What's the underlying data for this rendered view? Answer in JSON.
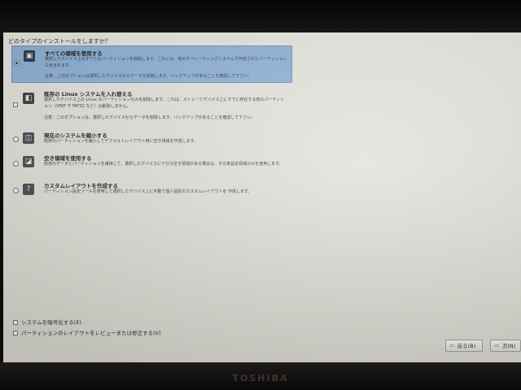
{
  "installer": {
    "question": "どのタイプのインストールをしますか？",
    "options": [
      {
        "title": "すべての領域を使用する",
        "description": "選択したデバイス上のすべてのパーティションを削除します。これには、他のオペレーティングシステムで作成されたパーティションも含まれます。",
        "warning": "注意：このオプションは選択したデバイスからデータを削除します。バックアップがあることを確認して下さい。",
        "icon": "drive-full-icon",
        "selected": true
      },
      {
        "title": "既存の Linux システムを入れ替える",
        "description": "選択したデバイス上の Linux のパーティションのみを削除します。これは、ストレージデバイス上にすでに存在する他のパーティション（VFAT や FAT32 など）は削除しません。",
        "warning": "注意：このオプションは、選択したデバイスからデータを削除します。バックアップがあることを確認して下さい。",
        "icon": "linux-drive-icon",
        "selected": false
      },
      {
        "title": "現在のシステムを縮小する",
        "description": "既存のパーティションを縮小してデフォルトレイアウト用に空き領域を作成します。",
        "icon": "shrink-drive-icon",
        "selected": false
      },
      {
        "title": "空き領域を使用する",
        "description": "既存のデータとパーティションを維持して、選択したデバイスに十分な空き領域がある場合は、その未設定領域のみを使用します。",
        "icon": "free-space-icon",
        "selected": false
      },
      {
        "title": "カスタムレイアウトを作成する",
        "description": "パーティション設定ツールを使用して選択したデバイス上に手動で個人設定のカスタムレイアウトを 作成します。",
        "icon": "custom-layout-icon",
        "selected": false
      }
    ],
    "checkboxes": [
      {
        "label": "システムを暗号化する(E)",
        "checked": false
      },
      {
        "label": "パーティションのレイアウトをレビューまたは修正する(V)",
        "checked": false
      }
    ],
    "buttons": {
      "back": "戻る(B)",
      "next": "次(N)"
    },
    "brand": "TOSHIBA"
  },
  "colors": {
    "selection": "#8fb3d9",
    "background": "#e4e3dc",
    "button_arrow": "#2e5f9e"
  }
}
